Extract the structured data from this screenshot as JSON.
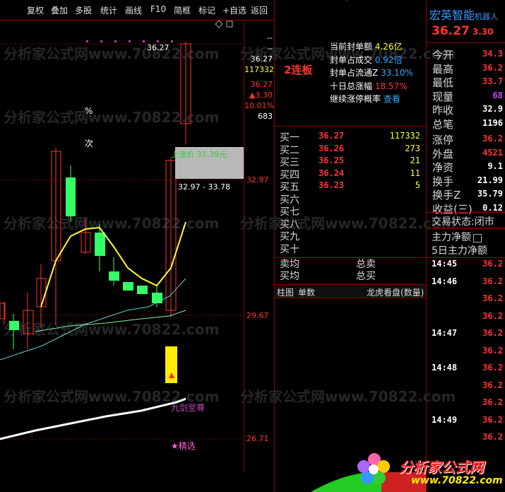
{
  "toolbar": {
    "items": [
      "复权",
      "叠加",
      "多股",
      "统计",
      "画线",
      "F10",
      "简框",
      "标记",
      "+自选",
      "返回"
    ]
  },
  "chart": {
    "price_labels": [
      "36.27",
      "32.97",
      "29.67",
      "26.71"
    ],
    "top_info": [
      "--",
      "--",
      "36.27",
      "117332",
      "36.27",
      "▲3.30",
      "10.01%",
      "683"
    ],
    "high_tag": "36.27",
    "pct_symbol": "%",
    "ci_label": "次",
    "limit_label": "上涨价 31.39元",
    "range_label": "32.97 - 33.78",
    "signal1": "九剑至尊",
    "signal2": "★精选"
  },
  "seal": {
    "board": "2连板",
    "rows": [
      {
        "label": "当前封单额",
        "value": "4.26亿"
      },
      {
        "label": "封单占成交",
        "value": "0.92倍"
      },
      {
        "label": "封单占流通Z",
        "value": "33.10%"
      },
      {
        "label": "十日总涨幅",
        "value": "18.57%"
      },
      {
        "label": "继续涨停概率",
        "value": "查看"
      }
    ]
  },
  "orderbook": {
    "buy": [
      {
        "label": "买一",
        "price": "36.27",
        "vol": "117332"
      },
      {
        "label": "买二",
        "price": "36.26",
        "vol": "273"
      },
      {
        "label": "买三",
        "price": "36.25",
        "vol": "21"
      },
      {
        "label": "买四",
        "price": "36.24",
        "vol": "11"
      },
      {
        "label": "买五",
        "price": "36.23",
        "vol": "5"
      },
      {
        "label": "买六",
        "price": "",
        "vol": ""
      },
      {
        "label": "买七",
        "price": "",
        "vol": ""
      },
      {
        "label": "买八",
        "price": "",
        "vol": ""
      },
      {
        "label": "买九",
        "price": "",
        "vol": ""
      },
      {
        "label": "买十",
        "price": "",
        "vol": ""
      }
    ],
    "avg": [
      {
        "left": "卖均",
        "right": "总卖"
      },
      {
        "left": "买均",
        "right": "总买"
      }
    ],
    "tabs": [
      "柱图",
      "单数",
      "龙虎看盘(数量)"
    ]
  },
  "stock": {
    "name": "宏英智能",
    "suffix": "机器人",
    "price": "36.27",
    "change": "3.30"
  },
  "quote_rows": [
    {
      "label": "今开",
      "value": "34.3"
    },
    {
      "label": "最高",
      "value": "36.2"
    },
    {
      "label": "最低",
      "value": "33.7"
    },
    {
      "label": "现量",
      "value": "68"
    },
    {
      "label": "昨收",
      "value": "32.9"
    },
    {
      "label": "总笔",
      "value": "1196"
    },
    {
      "label": "涨停",
      "value": "36.2"
    },
    {
      "label": "外盘",
      "value": "4521"
    },
    {
      "label": "净资",
      "value": "9.1"
    },
    {
      "label": "换手",
      "value": "21.99"
    },
    {
      "label": "换手Z",
      "value": "35.79"
    },
    {
      "label": "收益(三)",
      "value": "0.12"
    }
  ],
  "status": {
    "label": "交易状态:",
    "value": "闭市"
  },
  "flow": [
    "主力净额",
    "5日主力净额"
  ],
  "ticks": [
    {
      "time": "14:45",
      "price": "36.2"
    },
    {
      "time": "14:46",
      "price": "36.2"
    },
    {
      "time": "",
      "price": "36.2"
    },
    {
      "time": "",
      "price": "36.2"
    },
    {
      "time": "14:47",
      "price": "36.2"
    },
    {
      "time": "",
      "price": "36.2"
    },
    {
      "time": "14:48",
      "price": "36.2"
    },
    {
      "time": "",
      "price": "36.2"
    },
    {
      "time": "",
      "price": "36.2"
    },
    {
      "time": "14:49",
      "price": "36.2"
    },
    {
      "time": "",
      "price": "36.2"
    }
  ],
  "watermark": "分析家公式网www.70822.com",
  "logo": {
    "line1": "分析家公式网",
    "line2": "www.70822.com"
  },
  "colors": {
    "up": "#ff3333",
    "down": "#33ff66",
    "ma": "#ffff33",
    "grid": "#8b0000"
  }
}
